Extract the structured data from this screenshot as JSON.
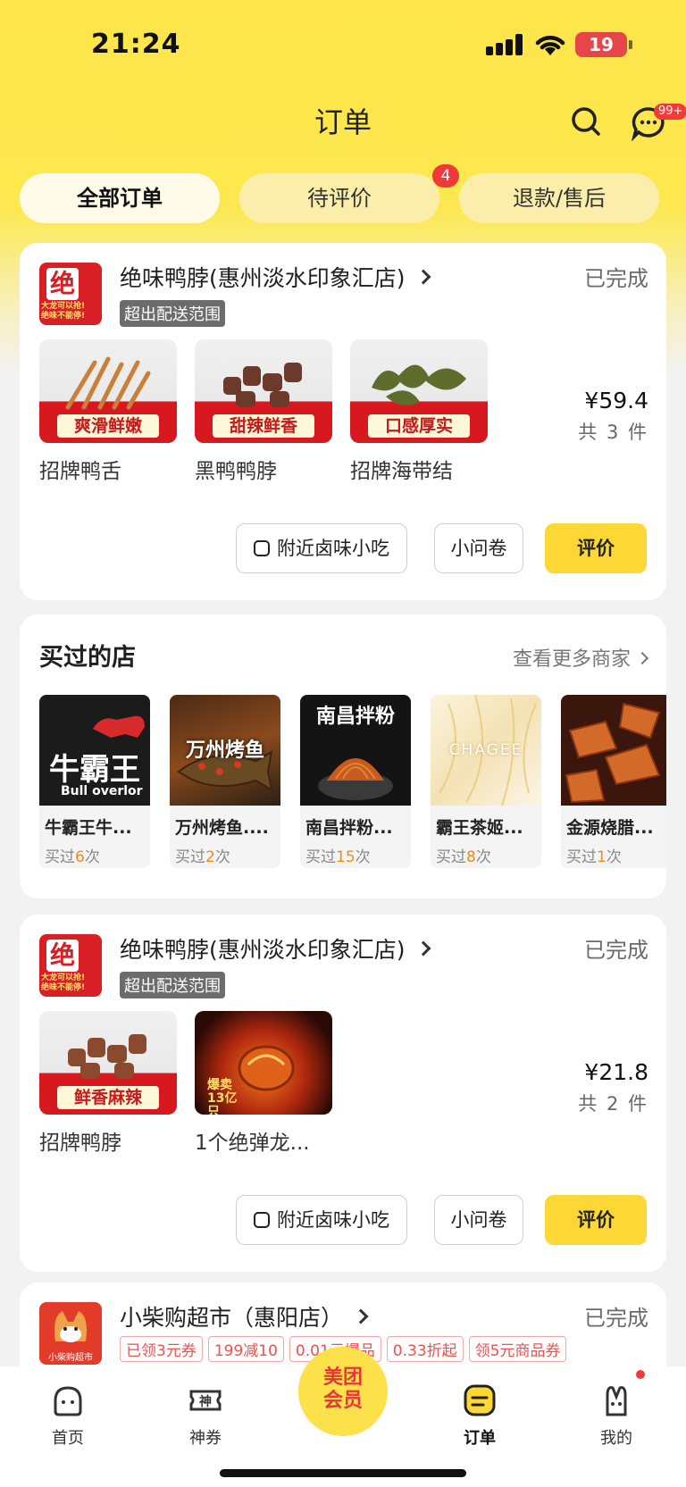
{
  "status_bar": {
    "time": "21:24",
    "battery": "19"
  },
  "nav": {
    "title": "订单",
    "msg_badge": "99+"
  },
  "tabs": [
    {
      "label": "全部订单"
    },
    {
      "label": "待评价",
      "badge": "4"
    },
    {
      "label": "退款/售后"
    }
  ],
  "orders": [
    {
      "shop_name": "绝味鸭脖(惠州淡水印象汇店)",
      "tag": "超出配送范围",
      "status": "已完成",
      "logo_text": "绝",
      "logo_sub": "大龙可以抢!\n绝味不能停!",
      "products": [
        {
          "name": "招牌鸭舌",
          "banner": "爽滑鲜嫩"
        },
        {
          "name": "黑鸭鸭脖",
          "banner": "甜辣鲜香"
        },
        {
          "name": "招牌海带结",
          "banner": "口感厚实"
        }
      ],
      "price": "¥59.4",
      "qty": "共 3 件",
      "buttons": {
        "nearby": "附近卤味小吃",
        "survey": "小问卷",
        "review": "评价"
      }
    },
    {
      "shop_name": "绝味鸭脖(惠州淡水印象汇店)",
      "tag": "超出配送范围",
      "status": "已完成",
      "logo_text": "绝",
      "logo_sub": "大龙可以抢!\n绝味不能停!",
      "products": [
        {
          "name": "招牌鸭脖",
          "banner": "鲜香麻辣"
        },
        {
          "name": "1个绝弹龙...",
          "banner": "爆卖13亿只"
        }
      ],
      "price": "¥21.8",
      "qty": "共 2 件",
      "buttons": {
        "nearby": "附近卤味小吃",
        "survey": "小问卷",
        "review": "评价"
      }
    },
    {
      "shop_name": "小柴购超市（惠阳店）",
      "status": "已完成",
      "logo_sub": "小柴购超市",
      "coupons": [
        "已领3元券",
        "199减10",
        "0.01元爆品",
        "0.33折起",
        "领5元商品券"
      ]
    }
  ],
  "bought_shops": {
    "title": "买过的店",
    "more": "查看更多商家",
    "items": [
      {
        "name": "牛霸王牛...",
        "prefix": "买过",
        "count": "6",
        "suffix": "次",
        "img_text": "牛霸王",
        "img_sub": "Bull overlor"
      },
      {
        "name": "万州烤鱼....",
        "prefix": "买过",
        "count": "2",
        "suffix": "次",
        "img_text": "万州烤鱼"
      },
      {
        "name": "南昌拌粉...",
        "prefix": "买过",
        "count": "15",
        "suffix": "次",
        "img_text": "南昌拌粉"
      },
      {
        "name": "霸王茶姬...",
        "prefix": "买过",
        "count": "8",
        "suffix": "次",
        "img_text": "CHAGEE"
      },
      {
        "name": "金源烧腊...",
        "prefix": "买过",
        "count": "1",
        "suffix": "次"
      }
    ]
  },
  "bottom_nav": [
    {
      "label": "首页"
    },
    {
      "label": "神券"
    },
    {
      "label": "美团\n会员"
    },
    {
      "label": "订单"
    },
    {
      "label": "我的"
    }
  ],
  "colors": {
    "accent": "#fdd835",
    "badge": "#f03a3a",
    "count": "#f08a19"
  }
}
